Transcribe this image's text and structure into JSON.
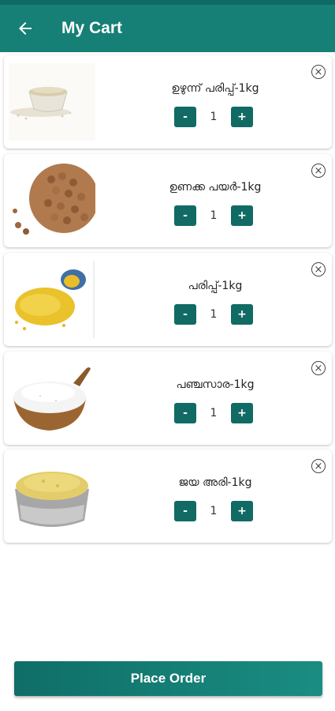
{
  "app": {
    "title": "My Cart"
  },
  "cart": {
    "items": [
      {
        "name": "ഉഴുന്ന് പരിപ്പ്-1kg",
        "quantity": "1",
        "image": "urad-dal-bowl"
      },
      {
        "name": "ഉണക്ക പയർ-1kg",
        "quantity": "1",
        "image": "dried-beans-bowl"
      },
      {
        "name": "പരിപ്പ്-1kg",
        "quantity": "1",
        "image": "moong-dal-spilled"
      },
      {
        "name": "പഞ്ചസാര-1kg",
        "quantity": "1",
        "image": "sugar-bowl"
      },
      {
        "name": "ജയ അരി-1kg",
        "quantity": "1",
        "image": "rice-bowl"
      }
    ],
    "minus_label": "-",
    "plus_label": "+",
    "remove_icon": "close-circle-icon"
  },
  "footer": {
    "place_order_label": "Place Order"
  },
  "colors": {
    "primary": "#167f76",
    "primary_dark": "#116b64",
    "statusbar": "#0d6b63"
  }
}
